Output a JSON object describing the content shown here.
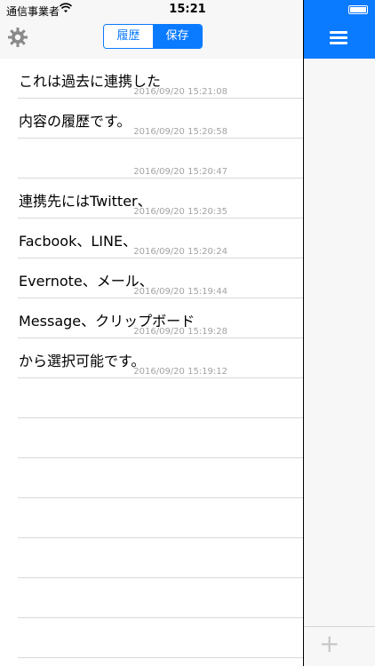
{
  "status": {
    "carrier": "通信事業者",
    "time": "15:21"
  },
  "header": {
    "segments": [
      "履歴",
      "保存"
    ],
    "active_segment": "保存"
  },
  "list": [
    {
      "text": "これは過去に連携した",
      "time": "2016/09/20 15:21:08"
    },
    {
      "text": "内容の履歴です。",
      "time": "2016/09/20 15:20:58"
    },
    {
      "text": "",
      "time": "2016/09/20 15:20:47"
    },
    {
      "text": "連携先にはTwitter、",
      "time": "2016/09/20 15:20:35"
    },
    {
      "text": "Facbook、LINE、",
      "time": "2016/09/20 15:20:24"
    },
    {
      "text": "Evernote、メール、",
      "time": "2016/09/20 15:19:44"
    },
    {
      "text": "Message、クリップボード",
      "time": "2016/09/20 15:19:28"
    },
    {
      "text": "から選択可能です。",
      "time": "2016/09/20 15:19:12"
    },
    {
      "text": "",
      "time": ""
    },
    {
      "text": "",
      "time": ""
    },
    {
      "text": "",
      "time": ""
    },
    {
      "text": "",
      "time": ""
    },
    {
      "text": "",
      "time": ""
    },
    {
      "text": "",
      "time": ""
    },
    {
      "text": "",
      "time": ""
    }
  ],
  "icons": {
    "settings": "gear-icon",
    "menu": "hamburger-menu-icon",
    "add": "plus-icon",
    "wifi": "wifi-icon",
    "battery": "battery-icon"
  },
  "colors": {
    "accent": "#0a7aff"
  }
}
